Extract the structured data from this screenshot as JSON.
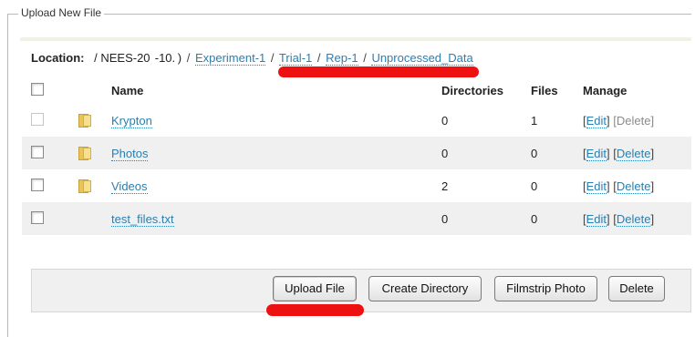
{
  "panel": {
    "legend": "Upload New File"
  },
  "location": {
    "label": "Location:",
    "static": "/ NEES-20  -10. )",
    "crumbs": [
      "Experiment-1",
      "Trial-1",
      "Rep-1",
      "Unprocessed_Data"
    ]
  },
  "table": {
    "headers": {
      "name": "Name",
      "directories": "Directories",
      "files": "Files",
      "manage": "Manage"
    },
    "rows": [
      {
        "name": "Krypton",
        "directories": "0",
        "files": "1",
        "edit": "Edit",
        "delete": "Delete",
        "is_folder": true,
        "delete_enabled": false
      },
      {
        "name": "Photos",
        "directories": "0",
        "files": "0",
        "edit": "Edit",
        "delete": "Delete",
        "is_folder": true,
        "delete_enabled": true
      },
      {
        "name": "Videos",
        "directories": "2",
        "files": "0",
        "edit": "Edit",
        "delete": "Delete",
        "is_folder": true,
        "delete_enabled": true
      },
      {
        "name": "test_files.txt",
        "directories": "0",
        "files": "0",
        "edit": "Edit",
        "delete": "Delete",
        "is_folder": false,
        "delete_enabled": true
      }
    ]
  },
  "buttons": {
    "upload": "Upload File",
    "create_directory": "Create Directory",
    "filmstrip": "Filmstrip Photo",
    "delete": "Delete"
  },
  "colors": {
    "link": "#2a7fb0",
    "annotation": "#ee1111",
    "row_alt": "#f0f0f0"
  }
}
